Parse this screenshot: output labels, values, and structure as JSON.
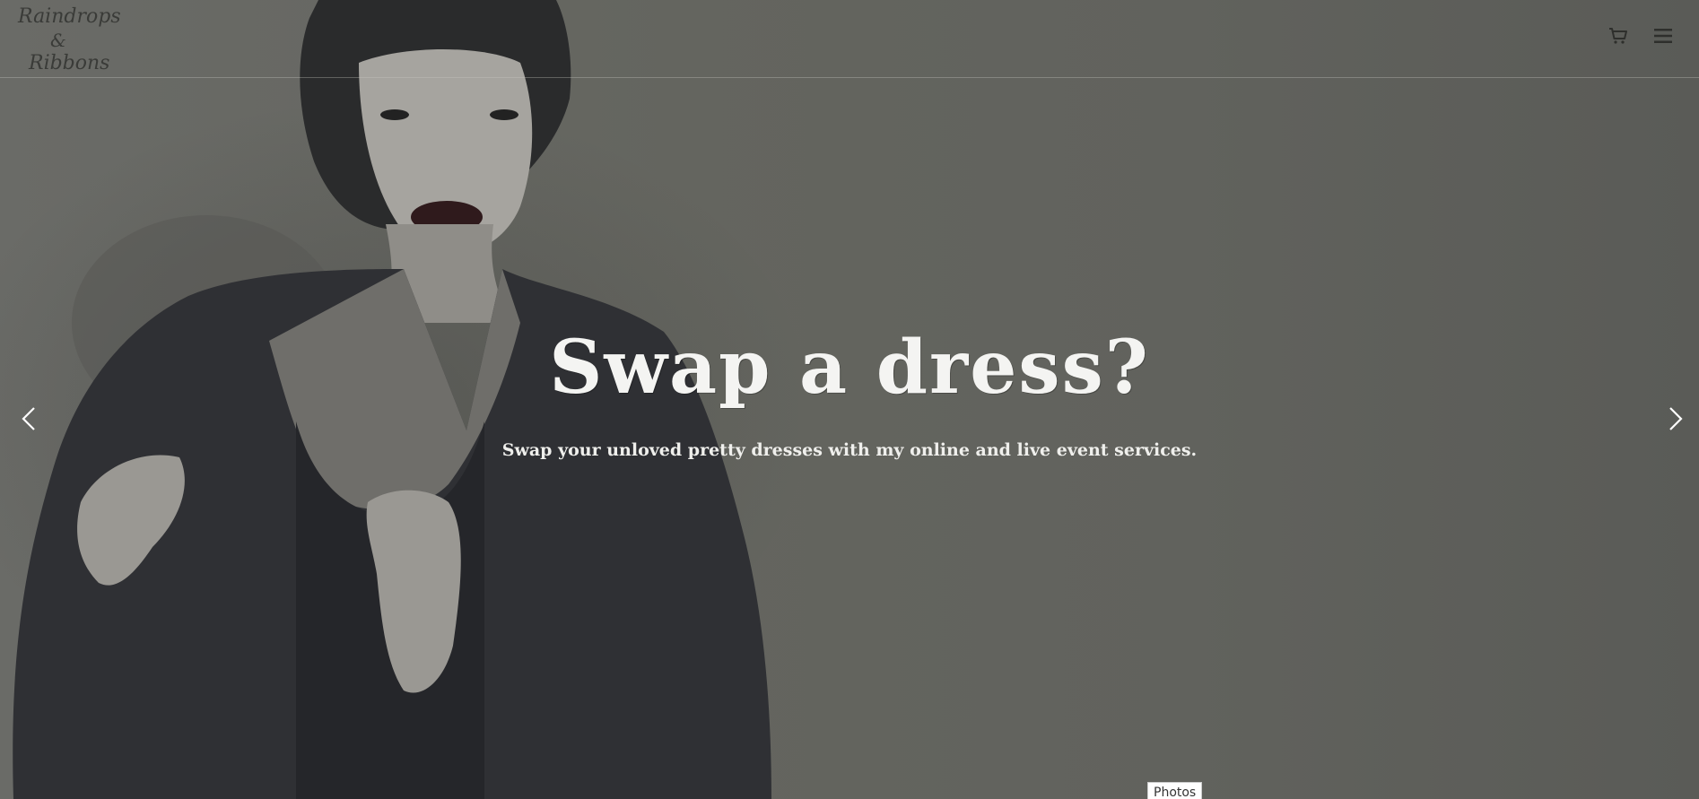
{
  "header": {
    "logo_line1": "Raindrops",
    "logo_line2": "&",
    "logo_line3": "Ribbons",
    "cart_icon": "shopping-cart-icon",
    "menu_icon": "hamburger-menu-icon"
  },
  "hero": {
    "title": "Swap a dress?",
    "subtitle": "Swap your unloved pretty dresses with my online and live event services."
  },
  "carousel": {
    "prev_icon": "chevron-left-icon",
    "next_icon": "chevron-right-icon"
  },
  "photos_tag": "Photos",
  "colors": {
    "overlay": "#5d5e5a",
    "text": "#f4f4f2",
    "icon": "#2e2f2c"
  }
}
